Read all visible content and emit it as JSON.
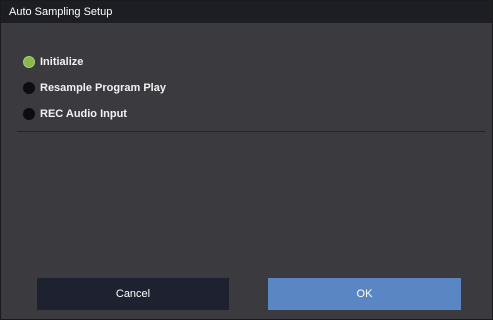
{
  "dialog": {
    "title": "Auto Sampling Setup"
  },
  "options": [
    {
      "label": "Initialize",
      "selected": true
    },
    {
      "label": "Resample Program Play",
      "selected": false
    },
    {
      "label": "REC Audio Input",
      "selected": false
    }
  ],
  "buttons": {
    "cancel_label": "Cancel",
    "ok_label": "OK"
  },
  "colors": {
    "background": "#3b3b3f",
    "title_bar": "#1c1e24",
    "selected_radio": "#8bb84a",
    "cancel_button": "#1d2130",
    "ok_button": "#5b86c4"
  }
}
